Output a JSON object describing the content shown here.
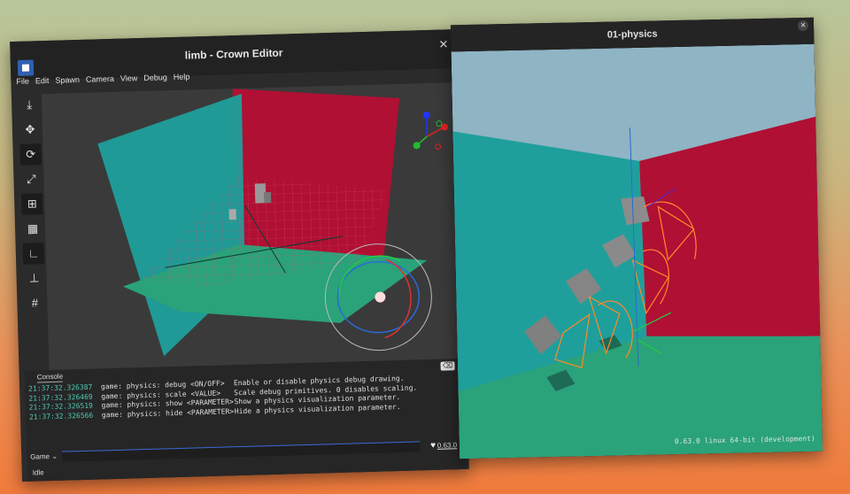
{
  "editor": {
    "title": "limb - Crown Editor",
    "menu": [
      "File",
      "Edit",
      "Spawn",
      "Camera",
      "View",
      "Debug",
      "Help"
    ],
    "tools": [
      {
        "icon": "place-icon",
        "glyph": "⤓"
      },
      {
        "icon": "move-icon",
        "glyph": "✥"
      },
      {
        "icon": "rotate-icon",
        "glyph": "⟳"
      },
      {
        "icon": "scale-icon",
        "glyph": "⤢"
      },
      {
        "icon": "snap-grid-icon",
        "glyph": "⊞"
      },
      {
        "icon": "grid-icon",
        "glyph": "▦"
      },
      {
        "icon": "local-axes-icon",
        "glyph": "∟"
      },
      {
        "icon": "snap-to-ground-icon",
        "glyph": "⊥"
      },
      {
        "icon": "reference-grid-icon",
        "glyph": "#"
      }
    ],
    "console": {
      "tab": "Console",
      "log": [
        {
          "time": "21:37:32.326387",
          "cmd": "game: physics: debug <ON/OFF>",
          "desc": "Enable or disable physics debug drawing."
        },
        {
          "time": "21:37:32.326469",
          "cmd": "game: physics: scale <VALUE>",
          "desc": "Scale debug primitives. 0 disables scaling."
        },
        {
          "time": "21:37:32.326519",
          "cmd": "game: physics: show <PARAMETER>",
          "desc": "Show a physics visualization parameter."
        },
        {
          "time": "21:37:32.326566",
          "cmd": "game: physics: hide <PARAMETER>",
          "desc": "Hide a physics visualization parameter."
        }
      ],
      "target": "Game",
      "input_value": ""
    },
    "version": "0.63.0",
    "status": "Idle"
  },
  "physics_window": {
    "title": "01-physics",
    "build_info": "0.63.0 linux 64-bit (development)"
  },
  "colors": {
    "wall_teal": "#1f9f9b",
    "wall_red": "#b01034",
    "floor_green": "#2aa27a",
    "sky": "#8fb4c4",
    "debug_orange": "#ff8a2a"
  }
}
